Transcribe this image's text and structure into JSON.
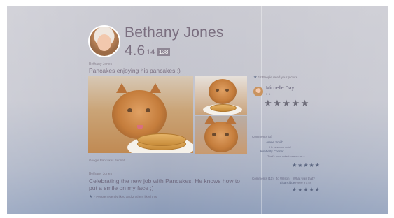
{
  "profile": {
    "name": "Bethany Jones",
    "rating": "4.6",
    "rating_count": "14",
    "rating_badge": "138"
  },
  "post1": {
    "author": "Bethany Jones",
    "title": "Pancakes enjoying his pancakes :)",
    "photo_caption": "Google Pancakes Bennet"
  },
  "post2": {
    "author": "Bethany Jones",
    "body": "Celebrating the new job with Pancakes. He knows how to put a smile on my face ;)",
    "meta": "7 People recently liked and 2 others liked this"
  },
  "right": {
    "like_text": "12 People rated your picture",
    "reviewer_name": "Michelle Day",
    "reviewer_sub": "5 ★",
    "reviewer_stars": "★★★★★",
    "comments_head": "Comments (3)",
    "comments": [
      {
        "name": "Lorene Smith",
        "text": "He is soooo cute!"
      },
      {
        "name": "Kimberly Conner",
        "text": "That's your cutest one so far x"
      }
    ],
    "comments_stars": "★★★★★",
    "comments_head_2_a": "Comments (11)",
    "comments_head_2_b": "Jo Wilson",
    "comments_head_2_c": "What was that?",
    "comments_head_2_d": "Lisa Ridge",
    "comments_head_2_e": "Prefer it a lot",
    "comments_stars_2": "★★★★★"
  },
  "colors": {
    "name_text": "#7b6f80",
    "accent_stars": "#6e6d7a"
  }
}
